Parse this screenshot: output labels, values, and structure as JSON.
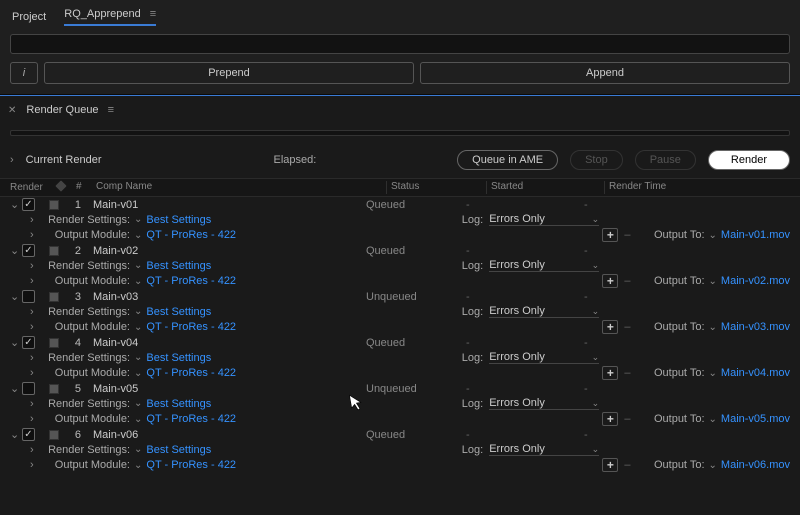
{
  "top": {
    "project_tab": "Project",
    "script_tab": "RQ_Apprepend",
    "info_btn": "i",
    "prepend_btn": "Prepend",
    "append_btn": "Append"
  },
  "rq": {
    "panel_title": "Render Queue",
    "current_render_label": "Current Render",
    "elapsed_label": "Elapsed:",
    "queue_ame_btn": "Queue in AME",
    "stop_btn": "Stop",
    "pause_btn": "Pause",
    "render_btn": "Render"
  },
  "headers": {
    "render": "Render",
    "num": "#",
    "comp": "Comp Name",
    "status": "Status",
    "started": "Started",
    "rtime": "Render Time"
  },
  "status": {
    "queued": "Queued",
    "unqueued": "Unqueued"
  },
  "sub": {
    "render_settings": "Render Settings:",
    "output_module": "Output Module:",
    "best_settings": "Best Settings",
    "prores": "QT - ProRes - 422",
    "log": "Log:",
    "output_to": "Output To:",
    "errors_only": "Errors Only"
  },
  "items": [
    {
      "num": "1",
      "checked": true,
      "name": "Main-v01",
      "status_key": "queued",
      "file": "Main-v01.mov"
    },
    {
      "num": "2",
      "checked": true,
      "name": "Main-v02",
      "status_key": "queued",
      "file": "Main-v02.mov"
    },
    {
      "num": "3",
      "checked": false,
      "name": "Main-v03",
      "status_key": "unqueued",
      "file": "Main-v03.mov"
    },
    {
      "num": "4",
      "checked": true,
      "name": "Main-v04",
      "status_key": "queued",
      "file": "Main-v04.mov"
    },
    {
      "num": "5",
      "checked": false,
      "name": "Main-v05",
      "status_key": "unqueued",
      "file": "Main-v05.mov"
    },
    {
      "num": "6",
      "checked": true,
      "name": "Main-v06",
      "status_key": "queued",
      "file": "Main-v06.mov"
    }
  ]
}
